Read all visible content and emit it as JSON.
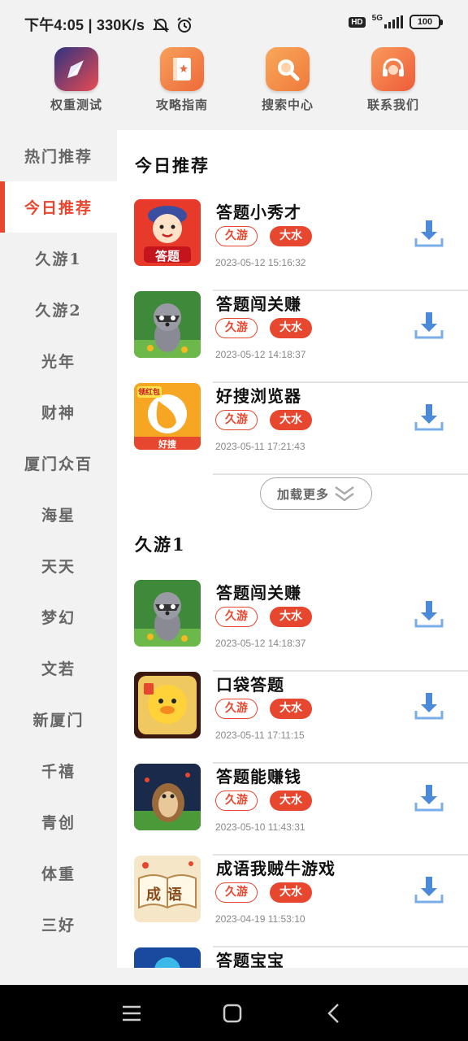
{
  "status_bar": {
    "time": "下午4:05",
    "speed": "330K/s",
    "network": "5G",
    "hd": "HD",
    "battery": "100"
  },
  "quick_nav": [
    {
      "label": "权重测试",
      "icon": "compass-icon",
      "color": "#3b3f8f"
    },
    {
      "label": "攻略指南",
      "icon": "guide-book-icon",
      "color": "#f27a3a"
    },
    {
      "label": "搜索中心",
      "icon": "search-icon",
      "color": "#f08a3a"
    },
    {
      "label": "联系我们",
      "icon": "headset-icon",
      "color": "#f0703a"
    }
  ],
  "sidebar": {
    "items": [
      {
        "label": "热门推荐"
      },
      {
        "label": "今日推荐"
      },
      {
        "label": "久游1"
      },
      {
        "label": "久游2"
      },
      {
        "label": "光年"
      },
      {
        "label": "财神"
      },
      {
        "label": "厦门众百"
      },
      {
        "label": "海星"
      },
      {
        "label": "天天"
      },
      {
        "label": "梦幻"
      },
      {
        "label": "文若"
      },
      {
        "label": "新厦门"
      },
      {
        "label": "千禧"
      },
      {
        "label": "青创"
      },
      {
        "label": "体重"
      },
      {
        "label": "三好"
      }
    ],
    "active_index": 1
  },
  "today": {
    "title": "今日推荐",
    "apps": [
      {
        "name": "答题小秀才",
        "tag1": "久游",
        "tag2": "大水",
        "date": "2023-05-12  15:16:32",
        "icon": "quiz-scholar-icon",
        "icon_text": "答题"
      },
      {
        "name": "答题闯关赚",
        "tag1": "久游",
        "tag2": "大水",
        "date": "2023-05-12  14:18:37",
        "icon": "raccoon-icon"
      },
      {
        "name": "好搜浏览器",
        "tag1": "久游",
        "tag2": "大水",
        "date": "2023-05-11  17:21:43",
        "icon": "browser-icon",
        "icon_text": "好搜",
        "badge": "领红包"
      }
    ],
    "load_more": "加载更多"
  },
  "jiuyou1": {
    "title": "久游1",
    "apps": [
      {
        "name": "答题闯关赚",
        "tag1": "久游",
        "tag2": "大水",
        "date": "2023-05-12  14:18:37",
        "icon": "raccoon-icon"
      },
      {
        "name": "口袋答题",
        "tag1": "久游",
        "tag2": "大水",
        "date": "2023-05-11  17:11:15",
        "icon": "duck-icon"
      },
      {
        "name": "答题能赚钱",
        "tag1": "久游",
        "tag2": "大水",
        "date": "2023-05-10  11:43:31",
        "icon": "hedgehog-icon"
      },
      {
        "name": "成语我贼牛游戏",
        "tag1": "久游",
        "tag2": "大水",
        "date": "2023-04-19  11:53:10",
        "icon": "idiom-book-icon",
        "icon_text": "成语"
      },
      {
        "name": "答题宝宝",
        "icon": "quiz-baby-icon"
      }
    ]
  },
  "colors": {
    "accent": "#e8472f",
    "download": "#4a8ad8"
  }
}
